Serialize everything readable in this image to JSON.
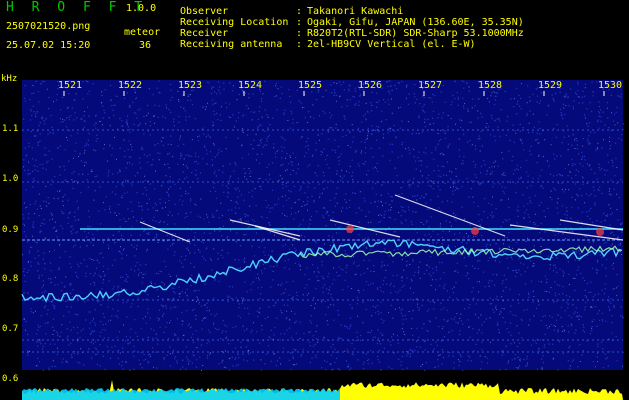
{
  "header": {
    "app_name": "H R O F F T",
    "version": "1.0.0",
    "filename": "2507021520.png",
    "datetime": "25.07.02 15:20",
    "meteor_label": "meteor",
    "meteor_count": "36",
    "info": [
      {
        "key": "Observer",
        "value": "Takanori Kawachi"
      },
      {
        "key": "Receiving Location",
        "value": "Ogaki, Gifu, JAPAN (136.60E, 35.35N)"
      },
      {
        "key": "Receiver",
        "value": "R820T2(RTL-SDR) SDR-Sharp 53.1000MHz"
      },
      {
        "key": "Receiving antenna",
        "value": "2el-HB9CV Vertical (el. E-W)"
      }
    ]
  },
  "axes": {
    "y_unit": "kHz",
    "y_ticks": [
      "1.1",
      "1.0",
      "0.9",
      "0.8",
      "0.7",
      "0.6"
    ],
    "x_ticks": [
      "1521",
      "1522",
      "1523",
      "1524",
      "1525",
      "1526",
      "1527",
      "1528",
      "1529",
      "1530"
    ]
  },
  "colors": {
    "background": "#050a7a",
    "carrier_line": "#40e0ff",
    "meteor_trail": "#ffffff",
    "signal_level": "#ffff00",
    "noise_floor": "#00d0ff"
  }
}
